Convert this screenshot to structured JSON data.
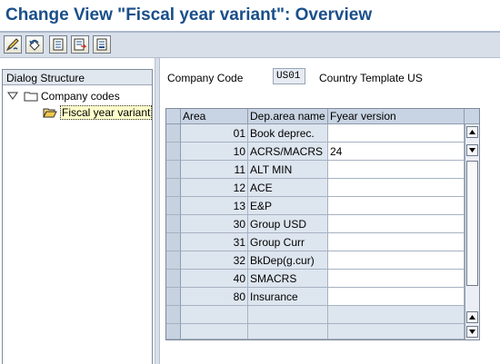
{
  "title": "Change View \"Fiscal year variant\": Overview",
  "toolbar": {
    "buttons": [
      "change-display-icon",
      "undo-icon",
      "document-icon",
      "document-export-icon",
      "document-list-icon"
    ]
  },
  "tree": {
    "header": "Dialog Structure",
    "items": [
      {
        "label": "Company codes",
        "expanded": true
      },
      {
        "label": "Fiscal year variant",
        "selected": true
      }
    ]
  },
  "form": {
    "company_code_label": "Company Code",
    "company_code_value": "US01",
    "company_code_desc": "Country Template US"
  },
  "table": {
    "columns": [
      "Area",
      "Dep.area name",
      "Fyear version"
    ],
    "rows": [
      {
        "area": "01",
        "name": "Book deprec.",
        "fyear": ""
      },
      {
        "area": "10",
        "name": "ACRS/MACRS",
        "fyear": "24"
      },
      {
        "area": "11",
        "name": "ALT MIN",
        "fyear": ""
      },
      {
        "area": "12",
        "name": "ACE",
        "fyear": ""
      },
      {
        "area": "13",
        "name": "E&P",
        "fyear": ""
      },
      {
        "area": "30",
        "name": "Group USD",
        "fyear": ""
      },
      {
        "area": "31",
        "name": "Group Curr",
        "fyear": ""
      },
      {
        "area": "32",
        "name": "BkDep(g.cur)",
        "fyear": ""
      },
      {
        "area": "40",
        "name": "SMACRS",
        "fyear": ""
      },
      {
        "area": "80",
        "name": "Insurance",
        "fyear": ""
      },
      {
        "area": "",
        "name": "",
        "fyear": ""
      }
    ]
  }
}
